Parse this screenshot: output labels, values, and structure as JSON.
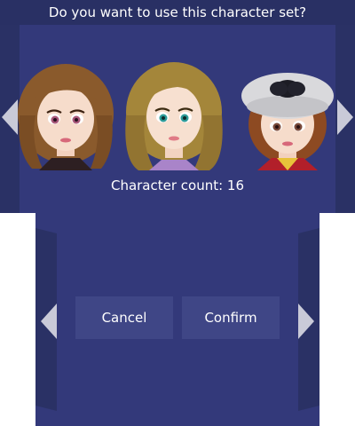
{
  "top": {
    "question": "Do you want to use this character set?",
    "count_text": "Character count: 16"
  },
  "characters": [
    {
      "hair": "brown wavy",
      "eyes": "pink"
    },
    {
      "hair": "golden long wavy",
      "eyes": "teal"
    },
    {
      "hair": "auburn short with grey beret",
      "eyes": "brown"
    }
  ],
  "buttons": {
    "cancel_label": "Cancel",
    "confirm_label": "Confirm"
  },
  "colors": {
    "background": "#33397a",
    "panel": "#2a3165",
    "button": "#3f4686",
    "arrow": "#c9cad8"
  },
  "icons": {
    "left_arrow": "triangle-left",
    "right_arrow": "triangle-right"
  }
}
